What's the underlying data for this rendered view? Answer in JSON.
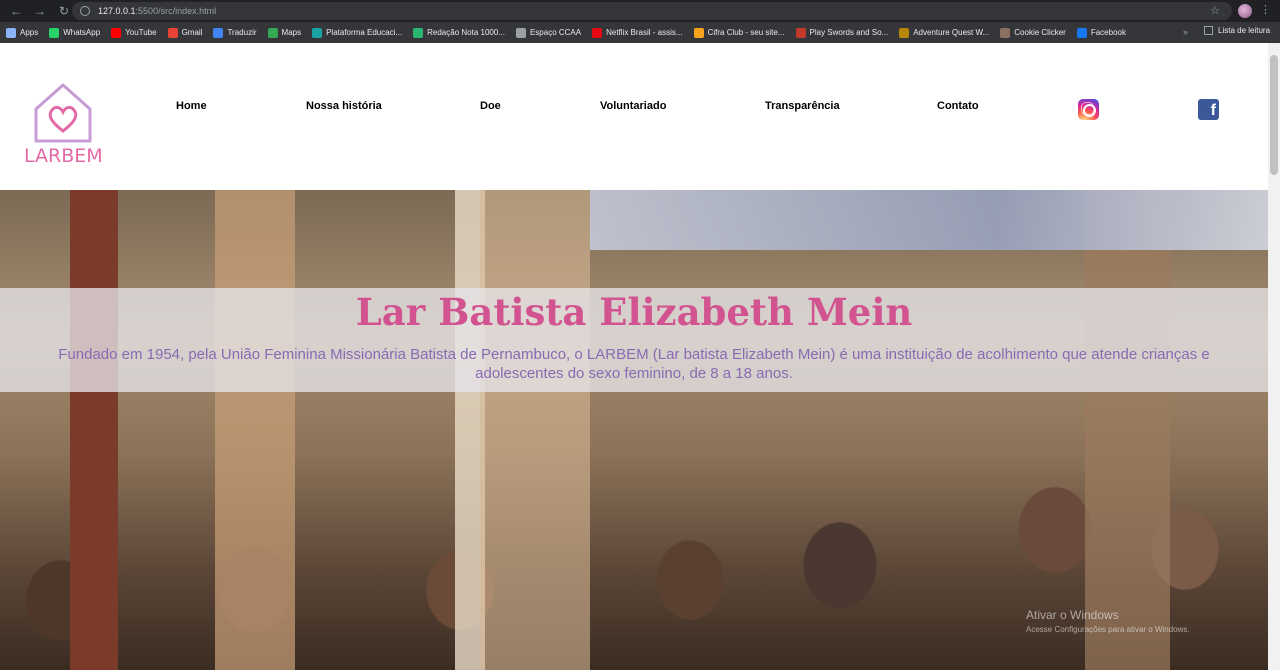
{
  "browser": {
    "url_host": "127.0.0.1",
    "url_path": ":5500/src/index.html",
    "bookmarks": [
      {
        "label": "Apps",
        "color": "#8ab4f8"
      },
      {
        "label": "WhatsApp",
        "color": "#25d366"
      },
      {
        "label": "YouTube",
        "color": "#ff0000"
      },
      {
        "label": "Gmail",
        "color": "#ea4335"
      },
      {
        "label": "Traduzir",
        "color": "#4285f4"
      },
      {
        "label": "Maps",
        "color": "#34a853"
      },
      {
        "label": "Plataforma Educaci...",
        "color": "#1aa3a3"
      },
      {
        "label": "Redação Nota 1000...",
        "color": "#2bb673"
      },
      {
        "label": "Espaço CCAA",
        "color": "#9aa0a6"
      },
      {
        "label": "Netflix Brasil - assis...",
        "color": "#e50914"
      },
      {
        "label": "Cifra Club - seu site...",
        "color": "#f7a21b"
      },
      {
        "label": "Play Swords and So...",
        "color": "#c0392b"
      },
      {
        "label": "Adventure Quest W...",
        "color": "#b8860b"
      },
      {
        "label": "Cookie Clicker",
        "color": "#8d6e63"
      },
      {
        "label": "Facebook",
        "color": "#1877f2"
      }
    ],
    "more": "»",
    "reading_list": "Lista de leitura"
  },
  "site": {
    "logo_text": "LARBEM",
    "nav": [
      "Home",
      "Nossa história",
      "Doe",
      "Voluntariado",
      "Transparência",
      "Contato"
    ],
    "social": {
      "instagram": "instagram-icon",
      "facebook": "f"
    }
  },
  "hero": {
    "title": "Lar Batista Elizabeth Mein",
    "description": "Fundado em 1954, pela União Feminina Missionária Batista de Pernambuco, o LARBEM (Lar batista Elizabeth Mein) é uma instituição de acolhimento que atende crianças e adolescentes do sexo feminino, de 8 a 18 anos."
  },
  "watermark": {
    "title": "Ativar o Windows",
    "subtitle": "Acesse Configurações para ativar o Windows."
  },
  "colors": {
    "accent_pink": "#d1538f",
    "desc_purple": "#8a6ab3",
    "facebook_blue": "#3b5998"
  }
}
